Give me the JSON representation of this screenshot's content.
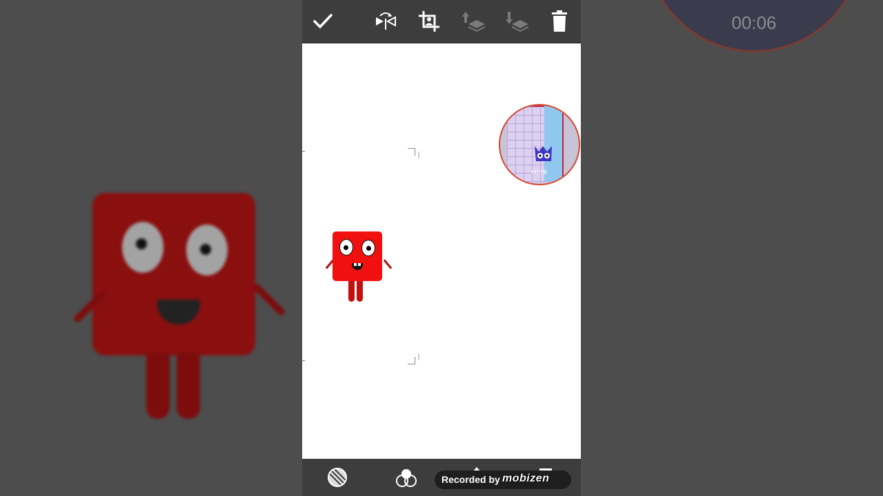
{
  "toolbar": {
    "confirm_icon": "check-icon",
    "flip_icon": "flip-icon",
    "crop_icon": "crop-icon",
    "layer_up_icon": "layer-up-icon",
    "layer_down_icon": "layer-down-icon",
    "delete_icon": "trash-icon"
  },
  "bottom_toolbar": {
    "items": [
      "opacity-icon",
      "blend-icon",
      "eraser-icon",
      "settings-icon"
    ]
  },
  "webcam": {
    "timer": "00:06"
  },
  "background_webcam": {
    "timer": "00:06"
  },
  "recorder": {
    "label": "Recorded by",
    "brand": "mobizen"
  },
  "colors": {
    "toolbar": "#3d3d3d",
    "character": "#f01010",
    "bubble_border": "#d8452e"
  }
}
